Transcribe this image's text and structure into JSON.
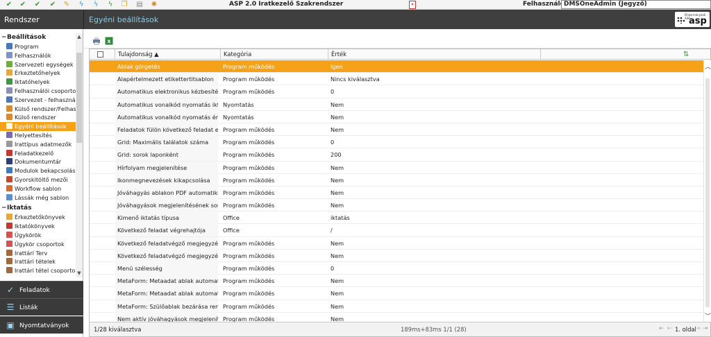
{
  "topbar": {
    "app_title": "ASP 2.0 Iratkezelő Szakrendszer",
    "user_label": "Felhasználó:",
    "user_value": "DMSOneAdmin (Jegyző)",
    "icons": [
      "check-icon",
      "check-icon",
      "check-icon",
      "edit-icon",
      "lightning-icon",
      "lightning-icon",
      "lightning-icon",
      "copy-icon",
      "document-icon",
      "user-icon",
      "sun-icon"
    ]
  },
  "header": {
    "section_title": "Rendszer",
    "page_title": "Egyéni beállítások",
    "logo_small": "Önkormányzati ASP",
    "logo_big": "asp"
  },
  "sidebar": {
    "sections": [
      {
        "title": "Beállítások",
        "items": [
          {
            "label": "Program",
            "icon": "link-icon",
            "color": "#4a78c0"
          },
          {
            "label": "Felhasználók",
            "icon": "users-icon",
            "color": "#7a95c9"
          },
          {
            "label": "Szervezeti egységek",
            "icon": "org-icon",
            "color": "#6fae3a"
          },
          {
            "label": "Érkeztetőhelyek",
            "icon": "inbox-icon",
            "color": "#e8a73a"
          },
          {
            "label": "Iktatóhelyek",
            "icon": "register-icon",
            "color": "#3d9a3d"
          },
          {
            "label": "Felhasználói csoportok",
            "icon": "group-icon",
            "color": "#8b8fb6"
          },
          {
            "label": "Szervezet - felhasználó",
            "icon": "link-icon",
            "color": "#4a78c0"
          },
          {
            "label": "Külső rendszer/Felhasz",
            "icon": "globe-icon",
            "color": "#d98b2b"
          },
          {
            "label": "Külső rendszer",
            "icon": "globe-icon",
            "color": "#d98b2b"
          },
          {
            "label": "Egyéni beállítások",
            "icon": "settings-icon",
            "color": "#ffffff",
            "active": true
          },
          {
            "label": "Helyettesítés",
            "icon": "swap-icon",
            "color": "#7b6bb3"
          },
          {
            "label": "Irattípus adatmezők",
            "icon": "fields-icon",
            "color": "#999999"
          },
          {
            "label": "Feladatkezelő",
            "icon": "tasks-icon",
            "color": "#c9382e"
          },
          {
            "label": "Dokumentumtár",
            "icon": "archive-icon",
            "color": "#2d3f7a"
          },
          {
            "label": "Modulok bekapcsolása",
            "icon": "modules-icon",
            "color": "#3b7bbf"
          },
          {
            "label": "Gyorskitöltő mezői",
            "icon": "quickfill-icon",
            "color": "#c24a2a"
          },
          {
            "label": "Workflow sablon",
            "icon": "workflow-icon",
            "color": "#d96a2a"
          },
          {
            "label": "Lássák még sablon",
            "icon": "visibility-icon",
            "color": "#5a8fd0"
          }
        ]
      },
      {
        "title": "Iktatás",
        "items": [
          {
            "label": "Érkeztetőkönyvek",
            "icon": "book-icon",
            "color": "#e8a73a"
          },
          {
            "label": "Iktatókönyvek",
            "icon": "book-icon",
            "color": "#c9382e"
          },
          {
            "label": "Ügykörök",
            "icon": "case-icon",
            "color": "#d95050"
          },
          {
            "label": "Ügykör csoportok",
            "icon": "case-group-icon",
            "color": "#d95050"
          },
          {
            "label": "Irattári Terv",
            "icon": "plan-icon",
            "color": "#a06a3a"
          },
          {
            "label": "Irattári tételek",
            "icon": "items-icon",
            "color": "#a06a3a"
          },
          {
            "label": "Irattári tétel csoportok",
            "icon": "items-group-icon",
            "color": "#a06a3a"
          }
        ]
      }
    ],
    "nav": [
      {
        "label": "Feladatok",
        "icon": "check-icon",
        "glyph": "✓"
      },
      {
        "label": "Listák",
        "icon": "list-icon",
        "glyph": "☰"
      },
      {
        "label": "Nyomtatványok",
        "icon": "form-icon",
        "glyph": "▣"
      }
    ]
  },
  "grid": {
    "columns": [
      "Tulajdonság ▲",
      "Kategória",
      "Érték"
    ],
    "rows": [
      {
        "property": "Ablak görgetés",
        "category": "Program működés",
        "value": "Igen",
        "selected": true
      },
      {
        "property": "Alapértelmezett etikettertitsablon",
        "category": "Program működés",
        "value": "Nincs kiválasztva"
      },
      {
        "property": "Automatikus elektronikus kézbesítés ...",
        "category": "Program működés",
        "value": "0"
      },
      {
        "property": "Automatikus vonalkód nyomatás iktat...",
        "category": "Nyomtatás",
        "value": "Nem"
      },
      {
        "property": "Automatikus vonalkód nyomatás érke...",
        "category": "Nyomtatás",
        "value": "Nem"
      },
      {
        "property": "Feladatok fülön következő feladat elv...",
        "category": "Program működés",
        "value": "Nem"
      },
      {
        "property": "Grid: Maximális találatok száma",
        "category": "Program működés",
        "value": "0"
      },
      {
        "property": "Grid: sorok laponként",
        "category": "Program működés",
        "value": "200"
      },
      {
        "property": "Hírfolyam megjelenítése",
        "category": "Program működés",
        "value": "Nem"
      },
      {
        "property": "Ikonmegnevezések kikapcsolása",
        "category": "Program működés",
        "value": "Nem"
      },
      {
        "property": "Jóváhagyás ablakon PDF automatiku...",
        "category": "Program működés",
        "value": "Nem"
      },
      {
        "property": "Jóváhagyások megjelenítésének sorr...",
        "category": "Program működés",
        "value": "Nem"
      },
      {
        "property": "Kimenő iktatás típusa",
        "category": "Office",
        "value": "iktatás"
      },
      {
        "property": "Következő feladat végrehajtója",
        "category": "Office",
        "value": "/"
      },
      {
        "property": "Következő feladatvégző megjegyzé...",
        "category": "Program működés",
        "value": "Nem"
      },
      {
        "property": "Következő feladatvégző megjegyzése...",
        "category": "Program működés",
        "value": "Nem"
      },
      {
        "property": "Menü szélesség",
        "category": "Program működés",
        "value": "0"
      },
      {
        "property": "MetaForm: Metaadat ablak automatik...",
        "category": "Program működés",
        "value": "Nem"
      },
      {
        "property": "MetaForm: Metaadat ablak automatik...",
        "category": "Program működés",
        "value": "Nem"
      },
      {
        "property": "MetaForm: Szülőablak bezárása rend...",
        "category": "Program működés",
        "value": "Nem"
      },
      {
        "property": "Nem aktív jóváhagyások megjelenítése",
        "category": "Program működés",
        "value": "Nem"
      }
    ],
    "footer": {
      "selection": "1/28 kiválasztva",
      "timing": "189ms+83ms 1/1 (28)",
      "page": "1. oldal"
    }
  },
  "colors": {
    "accent": "#f5a218",
    "header_bg": "#3f3f3f",
    "title_blue": "#8ecbe6"
  }
}
